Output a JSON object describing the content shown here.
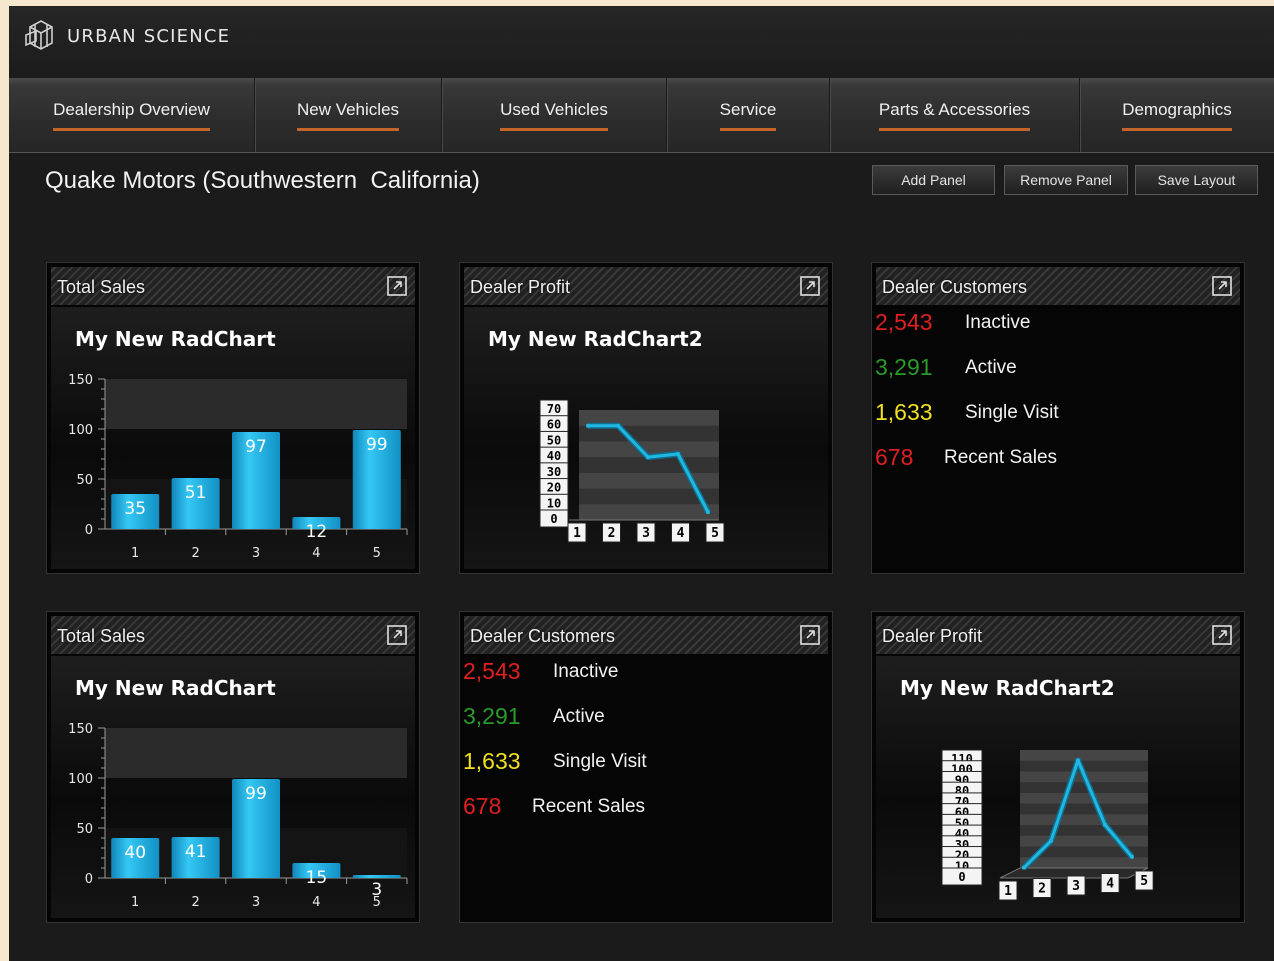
{
  "app": {
    "brand": "URBAN SCIENCE"
  },
  "nav": {
    "items": [
      {
        "label": "Dealership Overview"
      },
      {
        "label": "New Vehicles"
      },
      {
        "label": "Used Vehicles"
      },
      {
        "label": "Service"
      },
      {
        "label": "Parts & Accessories"
      },
      {
        "label": "Demographics"
      }
    ]
  },
  "page": {
    "title": "Quake Motors (Southwestern  California)"
  },
  "toolbar": {
    "add_label": "Add Panel",
    "remove_label": "Remove Panel",
    "save_label": "Save Layout"
  },
  "colors": {
    "accent": "#c5652a",
    "bar": "#1fb4e6",
    "inactive": "#e02020",
    "active": "#2a9a2a",
    "single_visit": "#f0e020",
    "recent_sales": "#e02020"
  },
  "panels": [
    {
      "title": "Total Sales"
    },
    {
      "title": "Dealer Profit"
    },
    {
      "title": "Dealer Customers"
    },
    {
      "title": "Total Sales"
    },
    {
      "title": "Dealer Customers"
    },
    {
      "title": "Dealer Profit"
    }
  ],
  "customers": {
    "rows": [
      {
        "value": "2,543",
        "label": "Inactive"
      },
      {
        "value": "3,291",
        "label": "Active"
      },
      {
        "value": "1,633",
        "label": "Single Visit"
      },
      {
        "value": "678",
        "label": "Recent Sales"
      }
    ]
  },
  "chart_data": [
    {
      "type": "bar",
      "title": "My New RadChart",
      "categories": [
        "1",
        "2",
        "3",
        "4",
        "5"
      ],
      "values": [
        35,
        51,
        97,
        12,
        99
      ],
      "ylim": [
        0,
        150
      ],
      "yticks": [
        0,
        50,
        100,
        150
      ]
    },
    {
      "type": "line",
      "title": "My New RadChart2",
      "categories": [
        "1",
        "2",
        "3",
        "4",
        "5"
      ],
      "values": [
        60,
        60,
        40,
        42,
        5
      ],
      "ylim": [
        0,
        70
      ],
      "yticks": [
        0,
        10,
        20,
        30,
        40,
        50,
        60,
        70
      ]
    },
    {
      "type": "bar",
      "title": "My New RadChart",
      "categories": [
        "1",
        "2",
        "3",
        "4",
        "5"
      ],
      "values": [
        40,
        41,
        99,
        15,
        3
      ],
      "ylim": [
        0,
        150
      ],
      "yticks": [
        0,
        50,
        100,
        150
      ]
    },
    {
      "type": "line",
      "title": "My New RadChart2",
      "categories": [
        "1",
        "2",
        "3",
        "4",
        "5"
      ],
      "values": [
        5,
        30,
        105,
        45,
        15
      ],
      "ylim": [
        0,
        110
      ],
      "yticks": [
        0,
        10,
        20,
        30,
        40,
        50,
        60,
        70,
        80,
        90,
        100,
        110
      ]
    }
  ]
}
